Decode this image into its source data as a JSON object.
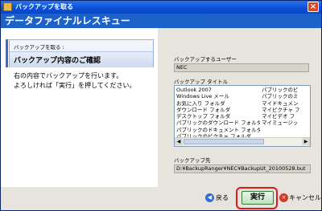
{
  "window": {
    "title": "バックアップを取る",
    "close_glyph": "×",
    "header_title": "データファイナルレスキュー"
  },
  "left": {
    "step_label": "バックアップを取る :",
    "section_title": "バックアップ内容のご確認",
    "instruction_line1": "右の内容でバックアップを行います。",
    "instruction_line2": "よろしければ「実行」を押してください。"
  },
  "right": {
    "user_label": "バックアップするユーザー",
    "user_value": "NEC",
    "title_label": "バックアップ タイトル",
    "items_col1": [
      "Outlook 2007",
      "Windows Live メール",
      "お気に入り フォルダ",
      "ダウンロード フォルダ",
      "デスクトップ フォルダ",
      "パブリックのダウンロード フォルダ",
      "パブリックのドキュメント フォルダ",
      "パブリックのピクチャ フォルダ"
    ],
    "items_col2": [
      "パブリックのビ",
      "パブリックのミ",
      "マイドキュメン",
      "マイピクチャ フ",
      "マイビデオ フ",
      "マイミュージッ"
    ],
    "scroll_left": "◀",
    "scroll_right": "▶",
    "dest_label": "バックアップ先",
    "dest_value": "D:¥BackupRanger¥NEC¥BackupUt_20100528.but"
  },
  "buttons": {
    "back_label": "戻る",
    "back_glyph": "◀",
    "exec_label": "実行",
    "cancel_label": "キャンセル",
    "cancel_glyph": "×"
  }
}
